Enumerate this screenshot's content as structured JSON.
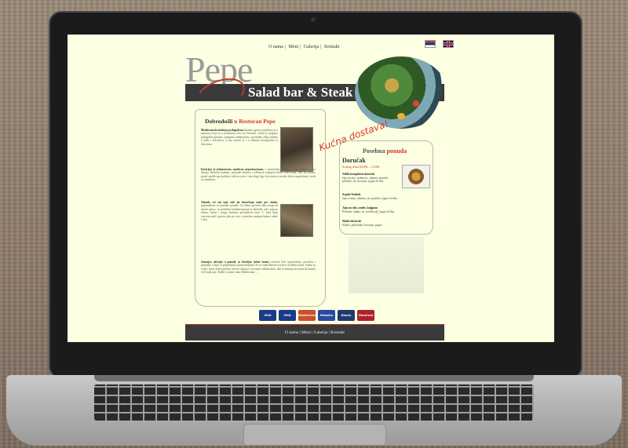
{
  "site": {
    "languages": [
      "sr",
      "en"
    ],
    "nav": [
      "O nama",
      "Meni",
      "Galerija",
      "Kontakt"
    ],
    "logo": "Pepe",
    "tagline": "Salad bar & Steak house",
    "delivery": "Kućna dostava!"
  },
  "welcome": {
    "title_prefix": "Dobrodošli",
    "title_highlight": "u Restoran Pepe",
    "p1_lead": "Mediteranska kuhinja prilagođena",
    "p1": "ukusima gosta, posluženo je u nemirnoj koja je u prometnoj ulici na Dorćolu. Lokal je potpuno prilagođen gostima, prijatnim ambijentom, opremljen zbog sedenja u bašti i enterijeru, u oba zdravo je i u obrnuto dostupnošću u obrocima.",
    "p2_lead": "Enterijer je jednostavan, moderno nepretenciozan,",
    "p2": "u neutralnim bojama, sa tek nekoliko retro detalja. Brzinom kuhinje, prijatnih kelnera i odličnom uslugom bićete zadovoljni, ono što dolazi, pored ostalih specijaliteta i izbora, jeste i ono zbog čega ćete nam se vraćati dobro raspoloženi i uvek sa osmehom.",
    "p3_lead": "Takođe, svi oni koji vole da doručkuju malo pre obeda,",
    "p3": "pripremljene su posebne ponude. Za dobar početak dana mogu da naruče gotov, sa različitim kombinacijama na doručak, sok i jaja po izboru, salate i druga dodatna specijaliteta kuće. U toku dana restoran nudi i gotova jela po ceni, a posebno preporučujemo salate i ribu.",
    "p4_lead": "Saznajte, uživajte u ponudi, sa dovoljno dobre hrane,",
    "p4": "ostavite loše raspoloženje, porodicu i prijatelje u kutu sa prijateljima, preporučujemo da se svakodnevno uverite u kvalitet hrane. Salate su sveže, mesa dobro pečena, deserti domaći i sve prati odlična kafa, dok je kuhinja otvorena do kasnih večernjih sati. Dođite i osetite ukus Mediterana.",
    "sign": "..."
  },
  "offer": {
    "title_prefix": "Posebna",
    "title_highlight": "ponuda",
    "section": "Doručak",
    "hours": "Svakog dana 08.00h – 11.00h",
    "items": [
      {
        "name": "Veliki kompletni doručak",
        "desc": "Jaja na oko, kobasice, slanina, pomfrit, pečurke, sir, kroasan, jogurt ili đus"
      },
      {
        "name": "Srpski fruštuk",
        "desc": "Jaja u tostu, slanina, sir, pomfrit, jogurt ili đus"
      },
      {
        "name": "Jaja na oko, omlet, kajgana",
        "desc": "Pečurke, šunka, sir, kačkavalj, jogurt ili đus"
      },
      {
        "name": "Slatki doručak",
        "desc": "Slatko, palačinke, kroasan, jogurt"
      }
    ]
  },
  "cards": [
    {
      "label": "VISA",
      "color": "#1a3a8a"
    },
    {
      "label": "VISA Electron",
      "color": "#1a3a8a"
    },
    {
      "label": "MasterCard",
      "color": "#c8502a"
    },
    {
      "label": "Maestro",
      "color": "#2a4aa0"
    },
    {
      "label": "Diners",
      "color": "#1e3a6e"
    },
    {
      "label": "DinaCard",
      "color": "#b0202a"
    }
  ],
  "footer": [
    "O nama",
    "Meni",
    "Galerija",
    "Kontakt"
  ]
}
